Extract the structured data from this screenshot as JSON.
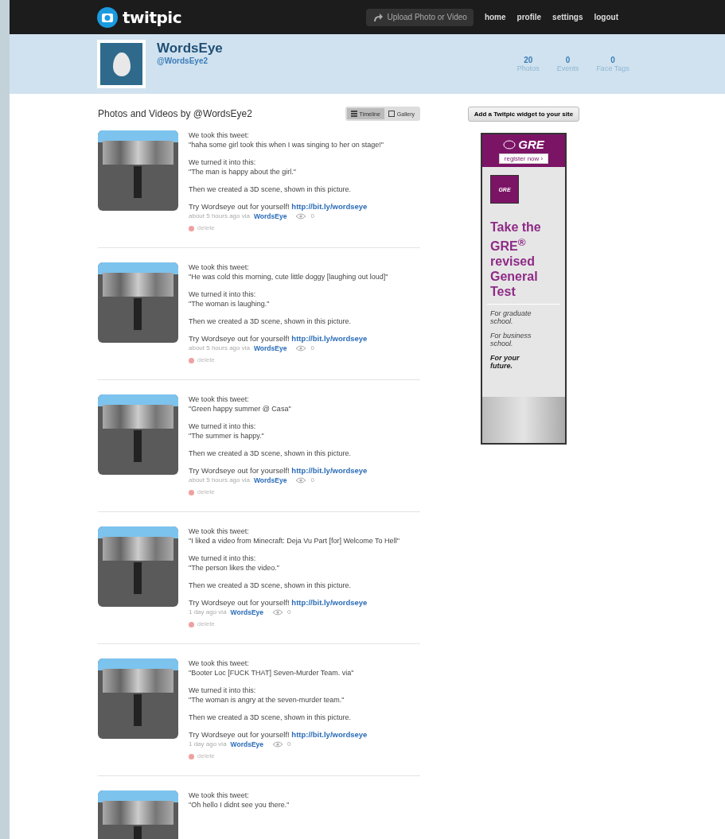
{
  "topbar": {
    "logo": "twitpic",
    "upload": "Upload Photo or Video",
    "nav": [
      "home",
      "profile",
      "settings",
      "logout"
    ]
  },
  "profile": {
    "name": "WordsEye",
    "handle": "@WordsEye2",
    "stats": [
      {
        "value": "20",
        "label": "Photos"
      },
      {
        "value": "0",
        "label": "Events"
      },
      {
        "value": "0",
        "label": "Face Tags"
      }
    ]
  },
  "feed": {
    "title": "Photos and Videos by @WordsEye2",
    "views": [
      {
        "label": "Timeline",
        "selected": true
      },
      {
        "label": "Gallery",
        "selected": false
      }
    ],
    "posts": [
      {
        "intro": "We took this tweet:",
        "tweet": "\"haha some girl took this when I was singing to her on stage!\"",
        "turned": "We turned it into this:",
        "result": "\"The man is happy about the girl.\"",
        "scene": "Then we created a 3D scene, shown in this picture.",
        "try": "Try Wordseye out for yourself!",
        "link": "http://bit.ly/wordseye",
        "time": "about 5 hours ago via",
        "via": "WordsEye",
        "views": "0",
        "delete": "delete"
      },
      {
        "intro": "We took this tweet:",
        "tweet": "\"He was cold this morning, cute little doggy [laughing out loud]\"",
        "turned": "We turned it into this:",
        "result": "\"The woman is laughing.\"",
        "scene": "Then we created a 3D scene, shown in this picture.",
        "try": "Try Wordseye out for yourself!",
        "link": "http://bit.ly/wordseye",
        "time": "about 5 hours ago via",
        "via": "WordsEye",
        "views": "0",
        "delete": "delete"
      },
      {
        "intro": "We took this tweet:",
        "tweet": "\"Green happy summer @ Casa\"",
        "turned": "We turned it into this:",
        "result": "\"The summer is happy.\"",
        "scene": "Then we created a 3D scene, shown in this picture.",
        "try": "Try Wordseye out for yourself!",
        "link": "http://bit.ly/wordseye",
        "time": "about 5 hours ago via",
        "via": "WordsEye",
        "views": "0",
        "delete": "delete"
      },
      {
        "intro": "We took this tweet:",
        "tweet": "\"I liked a video from Minecraft: Deja Vu Part [for] Welcome To Hell\"",
        "turned": "We turned it into this:",
        "result": "\"The person likes the video.\"",
        "scene": "Then we created a 3D scene, shown in this picture.",
        "try": "Try Wordseye out for yourself!",
        "link": "http://bit.ly/wordseye",
        "time": "1 day ago via",
        "via": "WordsEye",
        "views": "0",
        "delete": "delete"
      },
      {
        "intro": "We took this tweet:",
        "tweet": "\"Booter Loc [FUCK THAT] Seven-Murder Team. via\"",
        "turned": "We turned it into this:",
        "result": "\"The woman is angry at the seven-murder team.\"",
        "scene": "Then we created a 3D scene, shown in this picture.",
        "try": "Try Wordseye out for yourself!",
        "link": "http://bit.ly/wordseye",
        "time": "1 day ago via",
        "via": "WordsEye",
        "views": "0",
        "delete": "delete"
      },
      {
        "intro": "We took this tweet:",
        "tweet": "\"Oh hello I didnt see you there.\""
      }
    ]
  },
  "sidebar": {
    "widget_button": "Add a Twitpic widget to your site",
    "ad": {
      "brand": "GRE",
      "register": "register now ›",
      "tile": "GRE",
      "headline": "Take the GRE$^{®}$ revised General Test",
      "lines": [
        "For graduate school.",
        "For business school."
      ],
      "closing": "For your future."
    }
  }
}
